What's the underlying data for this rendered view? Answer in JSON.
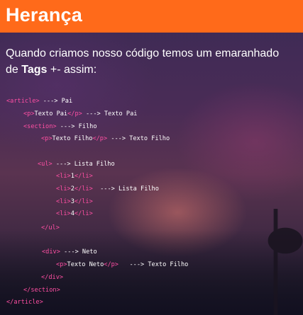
{
  "slide": {
    "title": "Herança",
    "intro_part1": "Quando criamos nosso código temos um emaranhado",
    "intro_part2_prefix": "de ",
    "intro_bold": "Tags",
    "intro_part2_suffix": " +- assim:"
  },
  "code_lines": [
    {
      "indent": 0,
      "tag": "<article>",
      "text": " ---> Pai"
    },
    {
      "indent": 1,
      "tag": "<p>",
      "text": "Texto Pai",
      "close": "</p>",
      "after": " ---> Texto Pai"
    },
    {
      "indent": 1,
      "tag": "<section>",
      "text": " ---> Filho"
    },
    {
      "indent": 2,
      "tag": "<p>",
      "text": "Texto Filho",
      "close": "</p>",
      "after": " ---> Texto Filho"
    },
    {
      "indent": 2,
      "tag": "<ul>",
      "text": " ---> Lista Filho"
    },
    {
      "indent": 3,
      "tag": "<li>",
      "text": "1",
      "close": "</li>"
    },
    {
      "indent": 3,
      "tag": "<li>",
      "text": "2",
      "close": "</li>",
      "after": "  ---> Lista Filho"
    },
    {
      "indent": 3,
      "tag": "<li>",
      "text": "3",
      "close": "</li>"
    },
    {
      "indent": 3,
      "tag": "<li>",
      "text": "4",
      "close": "</li>"
    },
    {
      "indent": 2,
      "tag": "</ul>",
      "text": ""
    },
    {
      "indent": 2,
      "tag": "<div>",
      "text": " ---> Neto"
    },
    {
      "indent": 3,
      "tag": "<p>",
      "text": "Texto Neto",
      "close": "</p>",
      "after": "   ---> Texto Filho"
    },
    {
      "indent": 2,
      "tag": "</div>",
      "text": ""
    },
    {
      "indent": 1,
      "tag": "</section>",
      "text": ""
    },
    {
      "indent": 0,
      "tag": "</article>",
      "text": ""
    }
  ],
  "colors": {
    "header_bg": "#ff6a1a",
    "tag": "#ff4fa3",
    "text": "#ffffff"
  }
}
